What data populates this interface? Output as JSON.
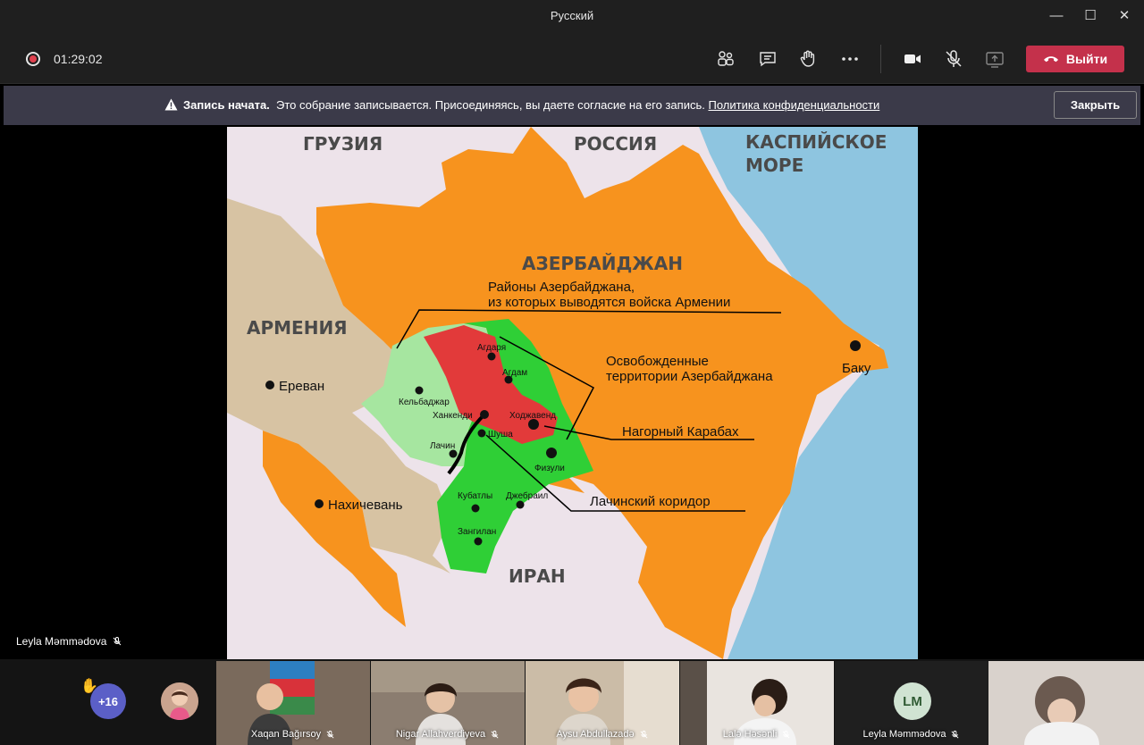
{
  "window": {
    "title": "Русский",
    "controls": {
      "minimize": "—",
      "maximize": "☐",
      "close": "✕"
    }
  },
  "toolbar": {
    "timer": "01:29:02",
    "leave_label": "Выйти",
    "leave_color": "#c4314b",
    "icons": [
      "participants-icon",
      "chat-icon",
      "raise-hand-icon",
      "more-icon",
      "camera-icon",
      "mic-off-icon",
      "share-icon"
    ]
  },
  "banner": {
    "bold": "Запись начата.",
    "text": "Это собрание записывается. Присоединяясь, вы даете согласие на его запись.",
    "link": "Политика конфиденциальности",
    "close_label": "Закрыть"
  },
  "map": {
    "countries": {
      "georgia": "ГРУЗИЯ",
      "russia": "РОССИЯ",
      "caspian_1": "КАСПИЙСКОЕ",
      "caspian_2": "МОРЕ",
      "azerbaijan": "АЗЕРБАЙДЖАН",
      "armenia": "АРМЕНИЯ",
      "iran": "ИРАН"
    },
    "cities": {
      "yerevan": "Ереван",
      "baku": "Баку",
      "nakhchivan": "Нахичевань",
      "agdara": "Агдаря",
      "agdam": "Агдам",
      "kelbajar": "Кельбаджар",
      "khankendi": "Ханкенди",
      "khojavend": "Ходжавенд",
      "shusha": "Шуша",
      "lachin": "Лачин",
      "fuzuli": "Физули",
      "kubatly": "Кубатлы",
      "jabrail": "Джебраил",
      "zangilan": "Зангилан"
    },
    "legend": {
      "withdrawn_1": "Районы Азербайджана,",
      "withdrawn_2": "из которых выводятся войска Армении",
      "liberated_1": "Освобожденные",
      "liberated_2": "территории Азербайджана",
      "karabakh": "Нагорный Карабах",
      "corridor": "Лачинский коридор"
    },
    "colors": {
      "azerbaijan": "#f7931e",
      "armenia": "#d7c3a3",
      "caspian": "#8ec5e0",
      "neighbors": "#ede3ea",
      "withdrawn": "#a6e6a0",
      "liberated": "#2fcf36",
      "karabakh": "#e23a3a"
    }
  },
  "presenter": {
    "name": "Leyla Məmmədova"
  },
  "participants": {
    "more_count": "+16",
    "tiles": [
      {
        "name": "Xaqan Bağırsoy"
      },
      {
        "name": "Nigar Allahverdiyeva"
      },
      {
        "name": "Aysu Abdullazadə"
      },
      {
        "name": "Lalə Həsənli"
      },
      {
        "name": "Leyla Məmmədova",
        "initials": "LM"
      },
      {
        "name": ""
      }
    ]
  }
}
